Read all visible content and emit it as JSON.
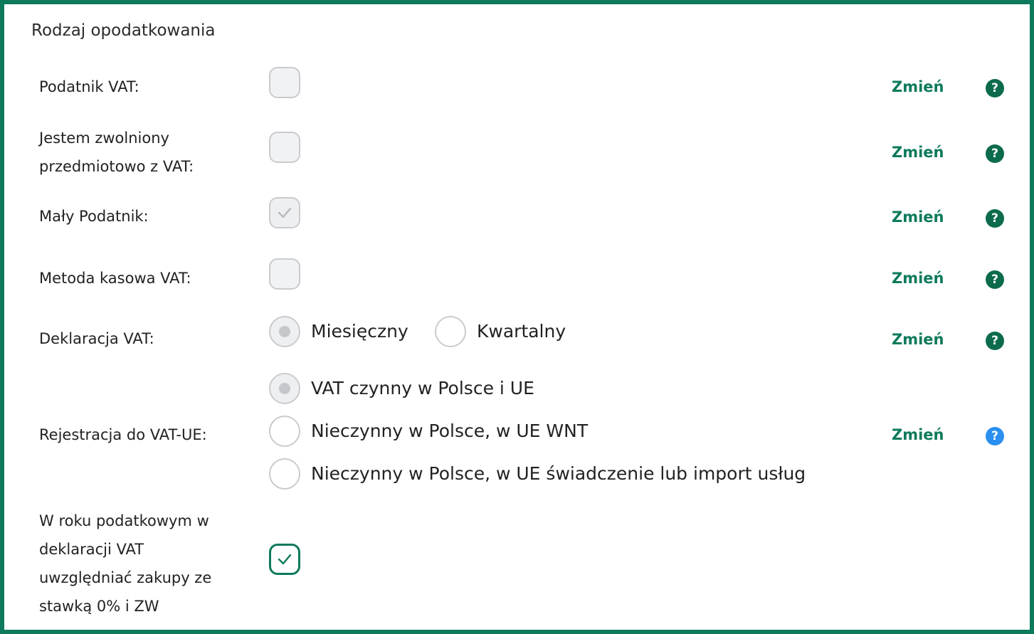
{
  "section": {
    "title": "Rodzaj opodatkowania"
  },
  "colors": {
    "accent": "#0d7a5c",
    "help_green": "#0d6b4d",
    "help_blue": "#2b8ff0"
  },
  "rows": {
    "vat_payer": {
      "label": "Podatnik VAT:",
      "checked": false,
      "change_label": "Zmień",
      "help_glyph": "?"
    },
    "vat_exempt": {
      "label_line1": "Jestem zwolniony",
      "label_line2": "przedmiotowo z VAT:",
      "checked": false,
      "change_label": "Zmień",
      "help_glyph": "?"
    },
    "small_taxpayer": {
      "label": "Mały Podatnik:",
      "checked": true,
      "change_label": "Zmień",
      "help_glyph": "?"
    },
    "cash_method": {
      "label": "Metoda kasowa VAT:",
      "checked": false,
      "change_label": "Zmień",
      "help_glyph": "?"
    },
    "vat_declaration": {
      "label": "Deklaracja VAT:",
      "options": [
        "Miesięczny",
        "Kwartalny"
      ],
      "selected": "Miesięczny",
      "change_label": "Zmień",
      "help_glyph": "?"
    },
    "vat_eu": {
      "label": "Rejestracja do VAT-UE:",
      "options": [
        "VAT czynny w Polsce i UE",
        "Nieczynny w Polsce, w UE WNT",
        "Nieczynny w Polsce, w UE świadczenie lub import usług"
      ],
      "selected": "VAT czynny w Polsce i UE",
      "change_label": "Zmień",
      "help_glyph": "?"
    },
    "zero_rate_purchases": {
      "label_line1": "W roku podatkowym w",
      "label_line2": "deklaracji VAT",
      "label_line3": "uwzględniać zakupy ze",
      "label_line4": "stawką 0% i ZW",
      "checked": true
    }
  }
}
